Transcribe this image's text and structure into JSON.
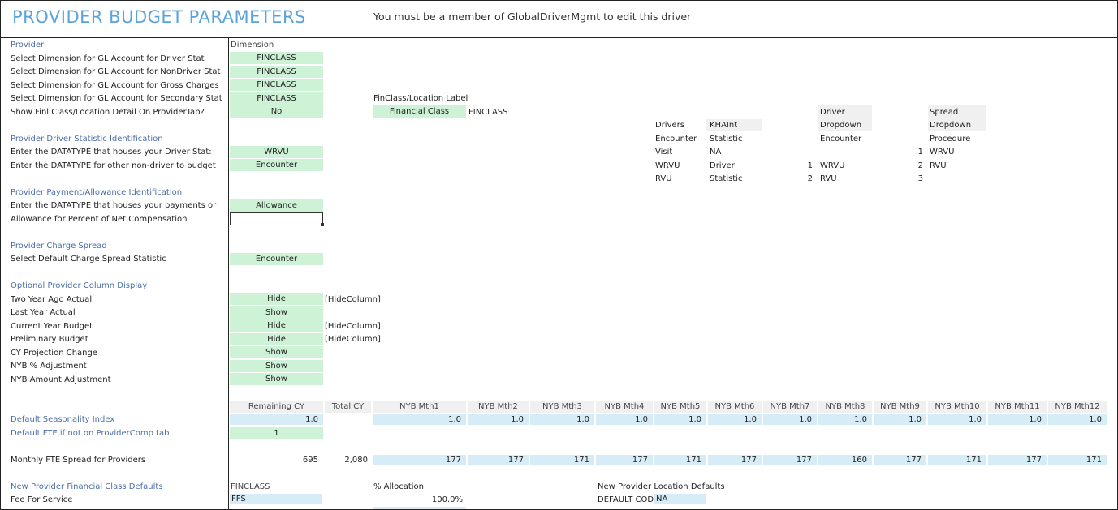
{
  "header": {
    "title": "PROVIDER BUDGET PARAMETERS",
    "message": "You must be a member of GlobalDriverMgmt to edit this driver"
  },
  "left_labels": {
    "provider": "Provider",
    "gl_driver": "Select Dimension for GL Account for Driver Stat",
    "gl_nondriver": "Select Dimension for GL Account for NonDriver Stat",
    "gl_gross": "Select Dimension for GL Account for Gross Charges",
    "gl_secondary": "Select Dimension for GL Account for Secondary Stat",
    "show_finl": "Show Finl Class/Location Detail On ProviderTab?",
    "sec_driver": "Provider Driver Statistic Identification",
    "datatype_driver": "Enter the DATATYPE that houses your Driver Stat:",
    "datatype_other": "Enter the DATATYPE for other non-driver to budget",
    "sec_payment": "Provider Payment/Allowance Identification",
    "datatype_payments": "Enter the DATATYPE that houses your payments or",
    "allowance_pct": "Allowance for Percent of Net Compensation",
    "sec_charge": "Provider Charge Spread",
    "default_charge": "Select Default Charge Spread Statistic",
    "sec_optional": "Optional Provider Column Display",
    "two_year": "Two Year Ago Actual",
    "last_year": "Last Year Actual",
    "current_year": "Current Year Budget",
    "prelim": "Preliminary Budget",
    "cy_proj": "CY Projection Change",
    "nyb_pct": "NYB % Adjustment",
    "nyb_amt": "NYB Amount Adjustment",
    "seasonality": "Default Seasonality Index",
    "default_fte": "Default FTE if not on ProviderComp tab",
    "monthly_fte": "Monthly FTE Spread for Providers",
    "new_fin_class": "New Provider Financial Class Defaults",
    "fee_for_service": "Fee For Service"
  },
  "values": {
    "dimension_header": "Dimension",
    "gl_driver": "FINCLASS",
    "gl_nondriver": "FINCLASS",
    "gl_gross": "FINCLASS",
    "gl_secondary": "FINCLASS",
    "show_finl": "No",
    "datatype_driver": "WRVU",
    "datatype_other": "Encounter",
    "datatype_payments": "Allowance",
    "allowance_pct": "",
    "default_charge": "Encounter",
    "two_year": "Hide",
    "last_year": "Show",
    "current_year": "Hide",
    "prelim": "Hide",
    "cy_proj": "Show",
    "nyb_pct": "Show",
    "nyb_amt": "Show",
    "hide_column_tag": "[HideColumn]",
    "default_fte": "1"
  },
  "finclass": {
    "label": "FinClass/Location Label",
    "button": "Financial Class",
    "code": "FINCLASS"
  },
  "lookup": {
    "drivers_header": "Drivers",
    "khaint_header": "KHAInt",
    "driver_header_1": "Driver",
    "driver_header_2": "Dropdown",
    "spread_header_1": "Spread",
    "spread_header_2": "Dropdown",
    "rows": [
      {
        "driver": "Encounter",
        "khaint": "Statistic",
        "dnum": "",
        "dval": "Encounter",
        "snum": "",
        "sval": "Procedure"
      },
      {
        "driver": "Visit",
        "khaint": "NA",
        "dnum": "",
        "dval": "",
        "snum": "1",
        "sval": "WRVU"
      },
      {
        "driver": "WRVU",
        "khaint": "Driver",
        "dnum": "1",
        "dval": "WRVU",
        "snum": "2",
        "sval": "RVU"
      },
      {
        "driver": "RVU",
        "khaint": "Statistic",
        "dnum": "2",
        "dval": "RVU",
        "snum": "3",
        "sval": ""
      }
    ]
  },
  "months": {
    "headers": [
      "Remaining CY",
      "Total CY",
      "NYB Mth1",
      "NYB Mth2",
      "NYB Mth3",
      "NYB Mth4",
      "NYB Mth5",
      "NYB Mth6",
      "NYB Mth7",
      "NYB Mth8",
      "NYB Mth9",
      "NYB Mth10",
      "NYB Mth11",
      "NYB Mth12"
    ],
    "seasonality": [
      "1.0",
      "",
      "1.0",
      "1.0",
      "1.0",
      "1.0",
      "1.0",
      "1.0",
      "1.0",
      "1.0",
      "1.0",
      "1.0",
      "1.0",
      "1.0"
    ],
    "fte": [
      "695",
      "2,080",
      "177",
      "177",
      "171",
      "177",
      "171",
      "177",
      "177",
      "160",
      "177",
      "171",
      "177",
      "171"
    ]
  },
  "defaults": {
    "finclass_header": "FINCLASS",
    "finclass_value": "FFS",
    "allocation_header": "% Allocation",
    "allocation_value": "100.0%",
    "location_header": "New Provider Location Defaults",
    "location_label": "DEFAULT CODI",
    "location_value": "NA"
  }
}
